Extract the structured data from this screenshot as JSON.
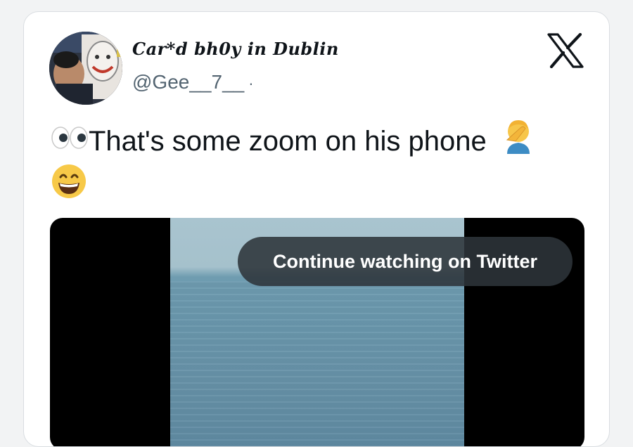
{
  "tweet": {
    "display_name": "Car*d bh0y in Dublin",
    "handle": "@Gee__7__",
    "separator": "·",
    "text": "That's some zoom on his phone",
    "leading_emoji_icon": "eyes-emoji-icon",
    "trailing_emoji_icons": [
      "facepalm-emoji-icon",
      "grinning-face-emoji-icon"
    ]
  },
  "media": {
    "overlay_label": "Continue watching on Twitter"
  },
  "colors": {
    "text": "#0f1419",
    "secondary_text": "#536471",
    "pill_bg": "#2e343a"
  }
}
